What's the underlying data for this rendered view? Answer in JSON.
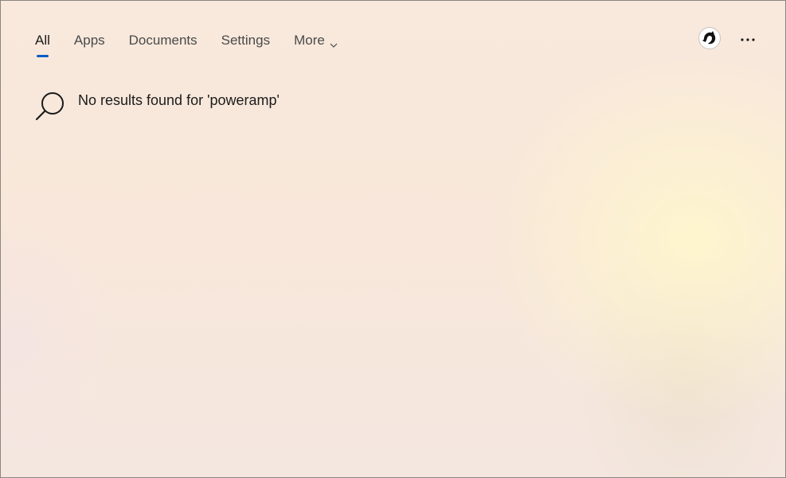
{
  "tabs": [
    {
      "label": "All",
      "active": true
    },
    {
      "label": "Apps",
      "active": false
    },
    {
      "label": "Documents",
      "active": false
    },
    {
      "label": "Settings",
      "active": false
    },
    {
      "label": "More",
      "active": false,
      "icon": "chevron-down-icon"
    }
  ],
  "header": {
    "avatar_icon": "user-avatar-icon",
    "more_options_icon": "ellipsis-icon"
  },
  "results": {
    "icon": "search-icon",
    "message": "No results found for 'poweramp'"
  },
  "colors": {
    "accent": "#0a5cc4",
    "text": "#1b1b1b",
    "tab_text": "#4a4a4a",
    "background": "#f8e9dc"
  }
}
